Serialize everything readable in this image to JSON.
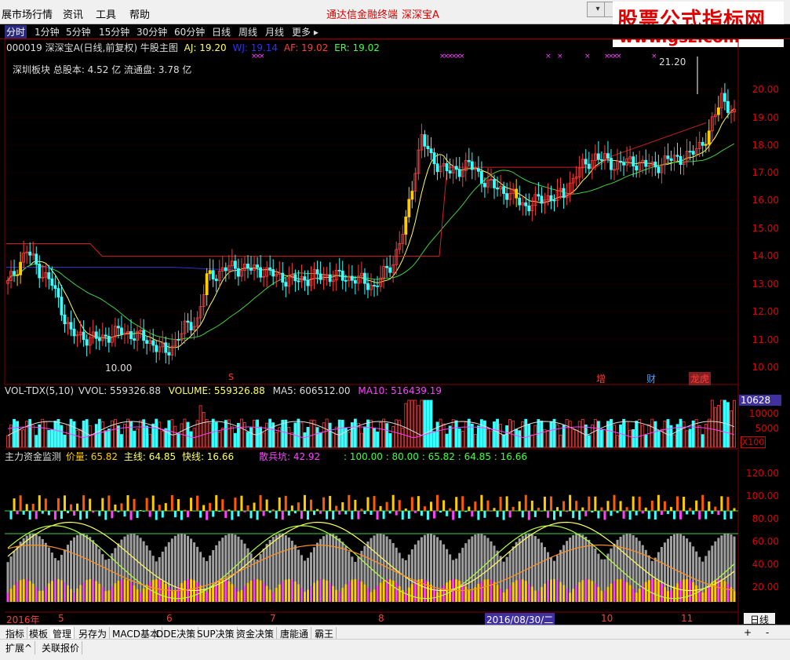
{
  "menu": {
    "items": [
      "展市场行情",
      "资讯",
      "工具",
      "帮助"
    ],
    "hot_items": [
      "通达信金融终端",
      "深深宝A"
    ],
    "logo_line1": "股票公式指标网",
    "logo_line2": "www.gsz.com"
  },
  "periods": {
    "items": [
      "分时",
      "1分钟",
      "5分钟",
      "15分钟",
      "30分钟",
      "60分钟",
      "日线",
      "周线",
      "月线",
      "更多 ▸"
    ],
    "active": "分时"
  },
  "chart_title": {
    "stock": "000019 深深宝A(日线,前复权) 牛股主图",
    "aj": "AJ: 19.20",
    "wj": "WJ: 19.14",
    "af": "AF: 19.02",
    "er": "ER: 19.02",
    "sector": "深圳板块 总股本: 4.52 亿 流通盘: 3.78 亿"
  },
  "price_axis": [
    "20.00",
    "19.00",
    "18.00",
    "17.00",
    "16.00",
    "15.00",
    "14.00",
    "13.00",
    "12.00",
    "11.00",
    "10.00"
  ],
  "annotations": {
    "high_label": "21.20",
    "low_label": "10.00",
    "markers": [
      "增",
      "财",
      "龙虎"
    ],
    "s_marker": "S"
  },
  "volume": {
    "title": "VOL-TDX(5,10)",
    "vvol": "VVOL: 559326.88",
    "volume": "VOLUME: 559326.88",
    "ma5": "MA5: 606512.00",
    "ma10": "MA10: 516439.19",
    "axis": [
      "10000",
      "5000"
    ],
    "max_box": "10628",
    "unit_box": "X100"
  },
  "indicator": {
    "title": "主力资金监测",
    "jiali": "价量: 65.82",
    "zhuxian": "主线: 64.85",
    "kuaixian": "快线: 16.66",
    "sanbing": "散兵坑: 42.92",
    "levels": ": 100.00 : 80.00 : 65.82 : 64.85 : 16.66",
    "axis": [
      "120.00",
      "100.00",
      "80.00",
      "60.00",
      "40.00",
      "20.00"
    ]
  },
  "date_axis": {
    "labels": [
      "2016年",
      "5",
      "6",
      "7",
      "8",
      "2016/08/30/二",
      "10",
      "11"
    ],
    "period_box": "日线"
  },
  "bottom_tabs": {
    "row1": [
      "指标",
      "模板",
      "管理",
      "另存为",
      "MACD基本",
      "DDE决策",
      "SUP决策",
      "资金决策",
      "唐能通",
      "霸王"
    ],
    "row2": [
      "扩展^",
      "关联报价"
    ],
    "corner": [
      "+",
      "-"
    ]
  },
  "colors": {
    "up": "#ff3c3c",
    "down": "#39ffff",
    "limit": "#ffcc00",
    "ma_yellow": "#ffff60",
    "ma_green": "#40d040",
    "resistance": "#d02020",
    "support_blue": "#3030d0",
    "magenta": "#ff40ff",
    "grey": "#a0a0a0"
  }
}
